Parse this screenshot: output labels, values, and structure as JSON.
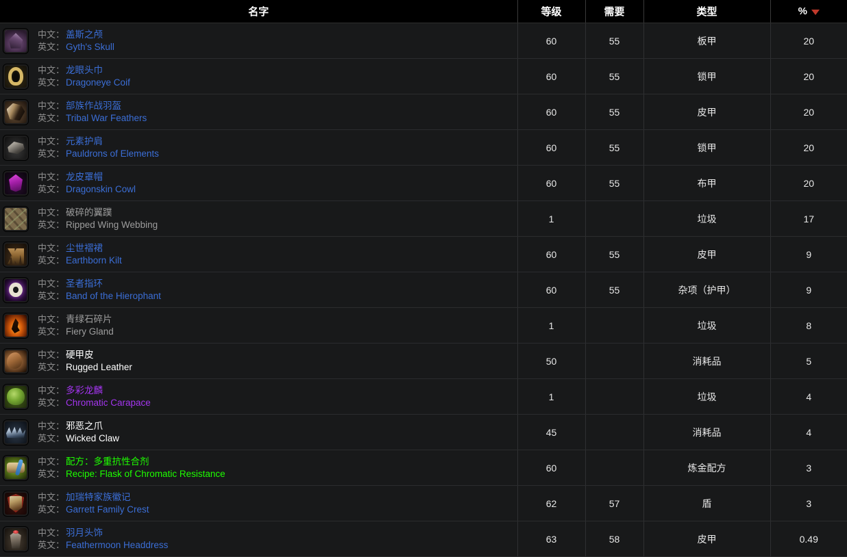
{
  "table": {
    "columns": [
      {
        "key": "name",
        "label": "名字",
        "sorted": false
      },
      {
        "key": "level",
        "label": "等级",
        "sorted": false
      },
      {
        "key": "req",
        "label": "需要",
        "sorted": false
      },
      {
        "key": "type",
        "label": "类型",
        "sorted": false
      },
      {
        "key": "pct",
        "label": "%",
        "sorted": true,
        "sort_direction": "desc"
      }
    ],
    "labels": {
      "zh": "中文：",
      "en": "英文："
    },
    "quality_colors": {
      "poor": "#9d9d9d",
      "common": "#ffffff",
      "uncommon": "#1eff00",
      "rare": "#3b6ed6",
      "epic": "#a335ee"
    },
    "accent": {
      "sort_arrow": "#c0392b",
      "header_bg": "#000000",
      "row_bg": "#18191a"
    },
    "rows": [
      {
        "icon": "helm-gyths-skull-icon",
        "art": "art-gyth",
        "zh": "盖斯之颅",
        "en": "Gyth's Skull",
        "quality": "rare",
        "level": "60",
        "req": "55",
        "type": "板甲",
        "pct": "20"
      },
      {
        "icon": "helm-dragoneye-coif-icon",
        "art": "art-dragoneye",
        "zh": "龙眼头巾",
        "en": "Dragoneye Coif",
        "quality": "rare",
        "level": "60",
        "req": "55",
        "type": "锁甲",
        "pct": "20"
      },
      {
        "icon": "helm-tribal-war-feathers-icon",
        "art": "art-tribal",
        "zh": "部族作战羽盔",
        "en": "Tribal War Feathers",
        "quality": "rare",
        "level": "60",
        "req": "55",
        "type": "皮甲",
        "pct": "20"
      },
      {
        "icon": "shoulder-pauldrons-icon",
        "art": "art-pauldrons",
        "zh": "元素护肩",
        "en": "Pauldrons of Elements",
        "quality": "rare",
        "level": "60",
        "req": "55",
        "type": "锁甲",
        "pct": "20"
      },
      {
        "icon": "helm-dragonskin-cowl-icon",
        "art": "art-dragonskin",
        "zh": "龙皮罩帽",
        "en": "Dragonskin Cowl",
        "quality": "rare",
        "level": "60",
        "req": "55",
        "type": "布甲",
        "pct": "20"
      },
      {
        "icon": "ripped-wing-webbing-icon",
        "art": "art-ripped",
        "zh": "破碎的翼蹼",
        "en": "Ripped Wing Webbing",
        "quality": "poor",
        "level": "1",
        "req": "",
        "type": "垃圾",
        "pct": "17"
      },
      {
        "icon": "legs-earthborn-kilt-icon",
        "art": "art-kilt",
        "zh": "尘世褶裙",
        "en": "Earthborn Kilt",
        "quality": "rare",
        "level": "60",
        "req": "55",
        "type": "皮甲",
        "pct": "9"
      },
      {
        "icon": "ring-band-hierophant-icon",
        "art": "art-band",
        "zh": "圣者指环",
        "en": "Band of the Hierophant",
        "quality": "rare",
        "level": "60",
        "req": "55",
        "type": "杂项（护甲）",
        "pct": "9"
      },
      {
        "icon": "fiery-gland-icon",
        "art": "art-fiery",
        "zh": "青绿石碎片",
        "en": "Fiery Gland",
        "quality": "poor",
        "level": "1",
        "req": "",
        "type": "垃圾",
        "pct": "8"
      },
      {
        "icon": "rugged-leather-icon",
        "art": "art-leather",
        "zh": "硬甲皮",
        "en": "Rugged Leather",
        "quality": "common",
        "level": "50",
        "req": "",
        "type": "消耗品",
        "pct": "5"
      },
      {
        "icon": "chromatic-carapace-icon",
        "art": "art-carapace",
        "zh": "多彩龙麟",
        "en": "Chromatic Carapace",
        "quality": "epic",
        "level": "1",
        "req": "",
        "type": "垃圾",
        "pct": "4"
      },
      {
        "icon": "wicked-claw-icon",
        "art": "art-claw",
        "zh": "邪恶之爪",
        "en": "Wicked Claw",
        "quality": "common",
        "level": "45",
        "req": "",
        "type": "消耗品",
        "pct": "4"
      },
      {
        "icon": "recipe-flask-chromatic-icon",
        "art": "art-recipe",
        "zh": "配方：多重抗性合剂",
        "en": "Recipe: Flask of Chromatic Resistance",
        "quality": "uncommon",
        "level": "60",
        "req": "",
        "type": "炼金配方",
        "pct": "3"
      },
      {
        "icon": "shield-garrett-crest-icon",
        "art": "art-crest",
        "zh": "加瑞特家族徽记",
        "en": "Garrett Family Crest",
        "quality": "rare",
        "level": "62",
        "req": "57",
        "type": "盾",
        "pct": "3"
      },
      {
        "icon": "helm-feathermoon-icon",
        "art": "art-feather",
        "zh": "羽月头饰",
        "en": "Feathermoon Headdress",
        "quality": "rare",
        "level": "63",
        "req": "58",
        "type": "皮甲",
        "pct": "0.49"
      }
    ]
  }
}
